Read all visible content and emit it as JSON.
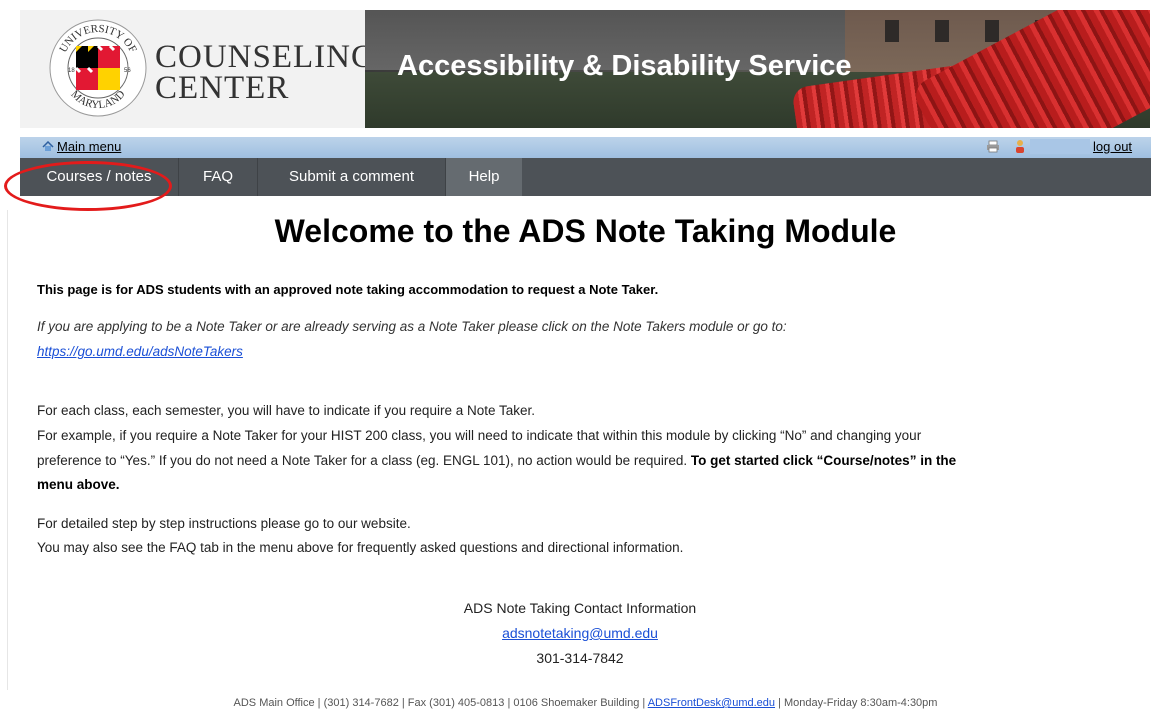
{
  "header": {
    "logo_line1": "COUNSELING",
    "logo_line2": "CENTER",
    "seal_top_text": "UNIVERSITY OF",
    "seal_bottom_text": "MARYLAND",
    "banner_title": "Accessibility & Disability Service"
  },
  "topbar": {
    "main_menu": "Main menu",
    "logout": "log out"
  },
  "nav": {
    "items": [
      {
        "label": "Courses / notes"
      },
      {
        "label": "FAQ"
      },
      {
        "label": "Submit a comment"
      },
      {
        "label": "Help"
      }
    ],
    "active_index": 3,
    "highlight_color": "#e31b1b"
  },
  "main": {
    "title": "Welcome to the ADS Note Taking Module",
    "intro_bold": "This page is for ADS students with an approved note taking accommodation to request a Note Taker.",
    "italic_note": "If you are applying to be a Note Taker or are already serving as a Note Taker please click on the Note Takers module or go to:",
    "italic_link": "https://go.umd.edu/adsNoteTakers",
    "para1_line1": "For each class, each semester, you will have to indicate if you require a Note Taker.",
    "para1_line2": "For example, if you require a Note Taker for your HIST 200 class, you will need to indicate that within this module by clicking “No” and changing your",
    "para1_line3_plain": "preference to “Yes.” If you do not need a Note Taker for a class (eg. ENGL 101), no action would be required. ",
    "para1_line3_bold": "To get started click “Course/notes” in the",
    "para1_line4_bold": "menu above.",
    "para2_line1": "For detailed step by step instructions please go to our website.",
    "para2_line2": "You may also see the FAQ tab in the menu above for frequently asked questions and directional information."
  },
  "contact": {
    "heading": "ADS Note Taking Contact Information",
    "email": "adsnotetaking@umd.edu",
    "phone": "301-314-7842"
  },
  "footer": {
    "text_before": "ADS Main Office | (301) 314-7682 | Fax (301) 405-0813 | 0106 Shoemaker Building | ",
    "email": "ADSFrontDesk@umd.edu",
    "text_after": " | Monday-Friday 8:30am-4:30pm"
  },
  "icons": {
    "home": "home-icon",
    "print": "print-icon",
    "user": "user-icon"
  },
  "colors": {
    "nav_bg": "#4d5257",
    "nav_active": "#656b70",
    "topbar": "#bcd3ea",
    "link": "#1a4fd6"
  }
}
